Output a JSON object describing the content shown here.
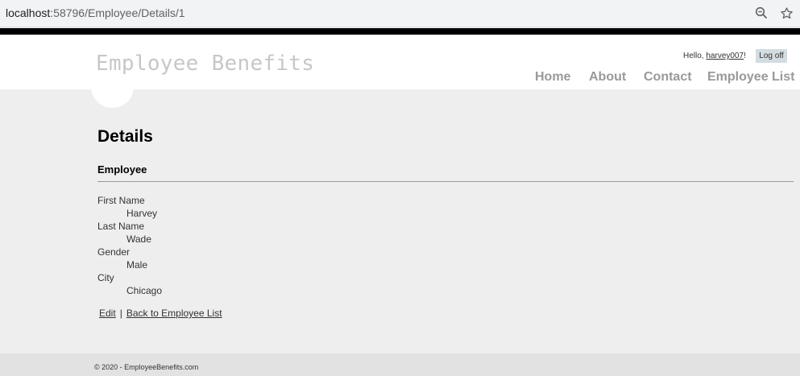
{
  "browser": {
    "url_host": "localhost",
    "url_rest": ":58796/Employee/Details/1",
    "icons": [
      "zoom-icon",
      "star-icon"
    ]
  },
  "header": {
    "brand": "Employee Benefits",
    "hello_prefix": "Hello, ",
    "username": "harvey007",
    "hello_suffix": "!",
    "logoff_label": "Log off",
    "nav": {
      "home": "Home",
      "about": "About",
      "contact": "Contact",
      "employee_list": "Employee List"
    }
  },
  "main": {
    "title": "Details",
    "section": "Employee",
    "fields": [
      {
        "label": "First Name",
        "value": "Harvey"
      },
      {
        "label": "Last Name",
        "value": "Wade"
      },
      {
        "label": "Gender",
        "value": "Male"
      },
      {
        "label": "City",
        "value": "Chicago"
      }
    ],
    "links": {
      "edit": "Edit",
      "separator": "|",
      "back": "Back to Employee List"
    }
  },
  "footer": {
    "copyright": "© 2020 - EmployeeBenefits.com"
  },
  "colors": {
    "page_bg": "#efeeef",
    "header_bg": "#ffffff",
    "brand": "#c7c7c7",
    "nav": "#999999",
    "logoff_bg": "#d3dce0",
    "footer_bg": "#e2e2e2"
  }
}
